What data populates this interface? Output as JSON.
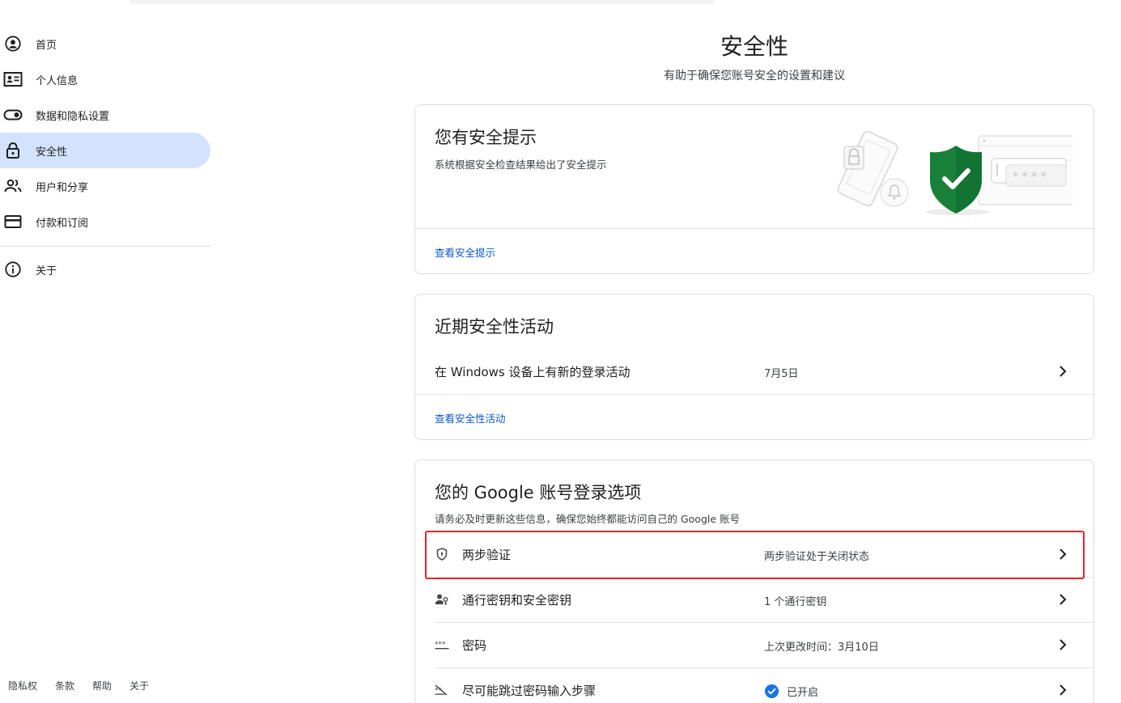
{
  "sidebar": {
    "items": [
      {
        "label": "首页",
        "icon": "account-circle-icon",
        "active": false
      },
      {
        "label": "个人信息",
        "icon": "id-card-icon",
        "active": false
      },
      {
        "label": "数据和隐私设置",
        "icon": "toggle-icon",
        "active": false
      },
      {
        "label": "安全性",
        "icon": "lock-icon",
        "active": true
      },
      {
        "label": "用户和分享",
        "icon": "people-icon",
        "active": false
      },
      {
        "label": "付款和订阅",
        "icon": "credit-card-icon",
        "active": false
      }
    ],
    "about": {
      "label": "关于",
      "icon": "info-icon"
    }
  },
  "footer": {
    "privacy": "隐私权",
    "terms": "条款",
    "help": "帮助",
    "about": "关于"
  },
  "page": {
    "title": "安全性",
    "subtitle": "有助于确保您账号安全的设置和建议"
  },
  "security_tips": {
    "title": "您有安全提示",
    "description": "系统根据安全检查结果给出了安全提示",
    "link": "查看安全提示",
    "illustration_password_mask": "****"
  },
  "recent_activity": {
    "title": "近期安全性活动",
    "event": {
      "label": "在 Windows 设备上有新的登录活动",
      "date": "7月5日"
    },
    "link": "查看安全性活动"
  },
  "signin_options": {
    "title": "您的 Google 账号登录选项",
    "description": "请务必及时更新这些信息，确保您始终都能访问自己的 Google 账号",
    "rows": [
      {
        "label": "两步验证",
        "value": "两步验证处于关闭状态",
        "icon": "shield-icon"
      },
      {
        "label": "通行密钥和安全密钥",
        "value": "1 个通行密钥",
        "icon": "person-key-icon"
      },
      {
        "label": "密码",
        "value": "上次更改时间：3月10日",
        "icon": "password-dots-icon"
      },
      {
        "label": "尽可能跳过密码输入步骤",
        "value": "已开启",
        "icon": "skip-password-icon",
        "status_icon": "check-circle-icon"
      }
    ]
  },
  "colors": {
    "accent": "#0b57d0",
    "active_nav_bg": "#d3e3fd",
    "highlight": "#e3242b",
    "shield_green": "#188038"
  }
}
